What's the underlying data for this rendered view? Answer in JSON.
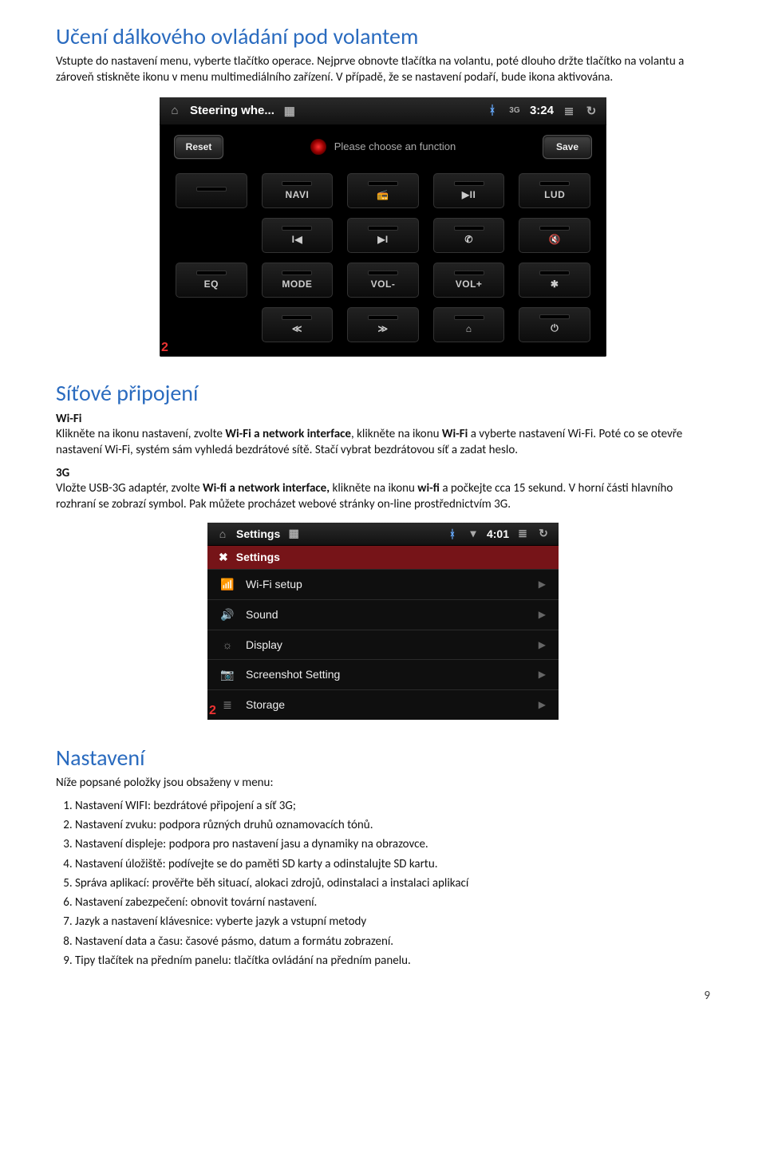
{
  "h1": "Učení dálkového ovládání pod volantem",
  "p1": "Vstupte do nastavení menu, vyberte tlačítko operace. Nejprve obnovte tlačítka na volantu, poté dlouho držte tlačítko na volantu a zároveň stiskněte ikonu v menu multimediálního zařízení. V případě, že se nastavení podaří, bude ikona aktivována.",
  "ss1": {
    "title": "Steering whe...",
    "time": "3:24",
    "reset": "Reset",
    "choose": "Please choose an function",
    "save": "Save",
    "corner": "2",
    "btns": [
      "",
      "NAVI",
      "📻",
      "▶II",
      "LUD",
      "I◀",
      "▶I",
      "✆",
      "🔇",
      "EQ",
      "MODE",
      "VOL-",
      "VOL+",
      "✱",
      "≪",
      "≫",
      "⌂",
      "⏻"
    ]
  },
  "h2": "Síťové připojení",
  "wifi_h": "Wi-Fi",
  "wifi_body_1": "Klikněte na ikonu nastavení, zvolte ",
  "wifi_bold_1": "Wi-Fi a network interface",
  "wifi_body_2": ", klikněte na ikonu ",
  "wifi_bold_2": "Wi-Fi",
  "wifi_body_3": " a vyberte nastavení Wi-Fi. Poté co se otevře nastavení Wi-Fi, systém sám vyhledá bezdrátové sítě. Stačí vybrat bezdrátovou síť a zadat heslo.",
  "g3_h": "3G",
  "g3_body_1": "Vložte USB-3G adaptér, zvolte ",
  "g3_bold_1": "Wi-fi a network interface,",
  "g3_body_2": " klikněte na ikonu ",
  "g3_bold_2": "wi-fi",
  "g3_body_3": " a počkejte cca 15 sekund. V horní části hlavního rozhraní se zobrazí symbol. Pak můžete procházet webové stránky on-line prostřednictvím 3G.",
  "ss2": {
    "title": "Settings",
    "time": "4:01",
    "header": "Settings",
    "rows": [
      {
        "icon": "📶",
        "label": "Wi-Fi setup"
      },
      {
        "icon": "🔊",
        "label": "Sound"
      },
      {
        "icon": "☼",
        "label": "Display"
      },
      {
        "icon": "📷",
        "label": "Screenshot Setting"
      },
      {
        "icon": "≣",
        "label": "Storage"
      }
    ],
    "corner": "2"
  },
  "h3": "Nastavení",
  "p3": "Níže popsané položky jsou obsaženy v menu:",
  "list": [
    "Nastavení WIFI: bezdrátové připojení a síť 3G;",
    "Nastavení zvuku: podpora různých druhů oznamovacích tónů.",
    "Nastavení displeje: podpora pro nastavení jasu a dynamiky na obrazovce.",
    "Nastavení úložiště: podívejte se do paměti SD karty a odinstalujte SD kartu.",
    "Správa aplikací: prověřte běh situací, alokaci zdrojů, odinstalaci a instalaci aplikací",
    "Nastavení zabezpečení: obnovit tovární nastavení.",
    "Jazyk a nastavení klávesnice: vyberte jazyk a vstupní metody",
    "Nastavení data a času: časové pásmo, datum a formátu zobrazení.",
    "Tipy tlačítek na předním panelu: tlačítka ovládání na předním panelu."
  ],
  "page": "9"
}
